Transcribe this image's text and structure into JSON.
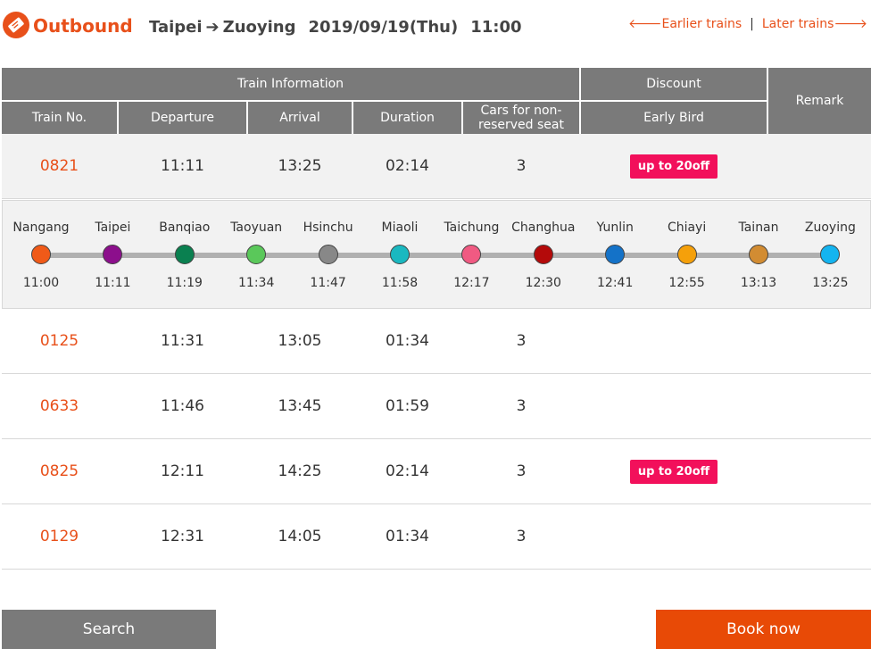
{
  "header": {
    "title": "Outbound",
    "from": "Taipei",
    "to": "Zuoying",
    "date": "2019/09/19(Thu)",
    "time": "11:00",
    "earlier": "Earlier trains",
    "separator": "|",
    "later": "Later trains",
    "accent": "#e8501a"
  },
  "table": {
    "group_info": "Train Information",
    "group_discount": "Discount",
    "remark": "Remark",
    "columns": {
      "train_no": "Train No.",
      "departure": "Departure",
      "arrival": "Arrival",
      "duration": "Duration",
      "cars": "Cars for non-reserved seat",
      "early_bird": "Early Bird"
    },
    "rows": [
      {
        "train_no": "0821",
        "departure": "11:11",
        "arrival": "13:25",
        "duration": "02:14",
        "cars": "3",
        "discount": "up to 20off"
      },
      {
        "train_no": "0125",
        "departure": "11:31",
        "arrival": "13:05",
        "duration": "01:34",
        "cars": "3",
        "discount": ""
      },
      {
        "train_no": "0633",
        "departure": "11:46",
        "arrival": "13:45",
        "duration": "01:59",
        "cars": "3",
        "discount": ""
      },
      {
        "train_no": "0825",
        "departure": "12:11",
        "arrival": "14:25",
        "duration": "02:14",
        "cars": "3",
        "discount": "up to 20off"
      },
      {
        "train_no": "0129",
        "departure": "12:31",
        "arrival": "14:05",
        "duration": "01:34",
        "cars": "3",
        "discount": ""
      }
    ]
  },
  "stops": [
    {
      "name": "Nangang",
      "time": "11:00",
      "color": "#f05a18"
    },
    {
      "name": "Taipei",
      "time": "11:11",
      "color": "#8c0f8c"
    },
    {
      "name": "Banqiao",
      "time": "11:19",
      "color": "#0a8050"
    },
    {
      "name": "Taoyuan",
      "time": "11:34",
      "color": "#5ac85a"
    },
    {
      "name": "Hsinchu",
      "time": "11:47",
      "color": "#888888"
    },
    {
      "name": "Miaoli",
      "time": "11:58",
      "color": "#1ab8c0"
    },
    {
      "name": "Taichung",
      "time": "12:17",
      "color": "#f05a82"
    },
    {
      "name": "Changhua",
      "time": "12:30",
      "color": "#b40a0a"
    },
    {
      "name": "Yunlin",
      "time": "12:41",
      "color": "#1472c8"
    },
    {
      "name": "Chiayi",
      "time": "12:55",
      "color": "#f5a00a"
    },
    {
      "name": "Tainan",
      "time": "13:13",
      "color": "#d28c32"
    },
    {
      "name": "Zuoying",
      "time": "13:25",
      "color": "#14b4f0"
    }
  ],
  "buttons": {
    "search": "Search",
    "book": "Book now"
  }
}
